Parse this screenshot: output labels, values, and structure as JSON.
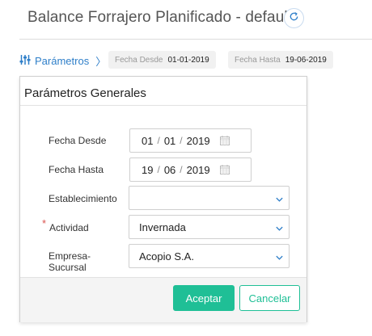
{
  "header": {
    "title": "Balance Forrajero Planificado - default",
    "refresh_icon": "refresh-icon"
  },
  "toolbar": {
    "params_label": "Parámetros",
    "params_icon": "sliders-icon",
    "chevron": "〉",
    "chips": [
      {
        "label": "Fecha Desde",
        "value": "01-01-2019"
      },
      {
        "label": "Fecha Hasta",
        "value": "19-06-2019"
      }
    ]
  },
  "panel": {
    "title": "Parámetros Generales",
    "fields": {
      "fecha_desde": {
        "label": "Fecha Desde",
        "day": "01",
        "month": "01",
        "year": "2019",
        "sep": "/"
      },
      "fecha_hasta": {
        "label": "Fecha Hasta",
        "day": "19",
        "month": "06",
        "year": "2019",
        "sep": "/"
      },
      "establecimiento": {
        "label": "Establecimiento",
        "value": ""
      },
      "actividad": {
        "label": "Actividad",
        "value": "Invernada",
        "required_mark": "*"
      },
      "empresa": {
        "label_line1": "Empresa-",
        "label_line2": "Sucursal",
        "value": "Acopio S.A."
      }
    },
    "buttons": {
      "accept": "Aceptar",
      "cancel": "Cancelar"
    }
  },
  "colors": {
    "accent": "#1fbf96",
    "link": "#2f7fc9",
    "required": "#d9534f"
  }
}
